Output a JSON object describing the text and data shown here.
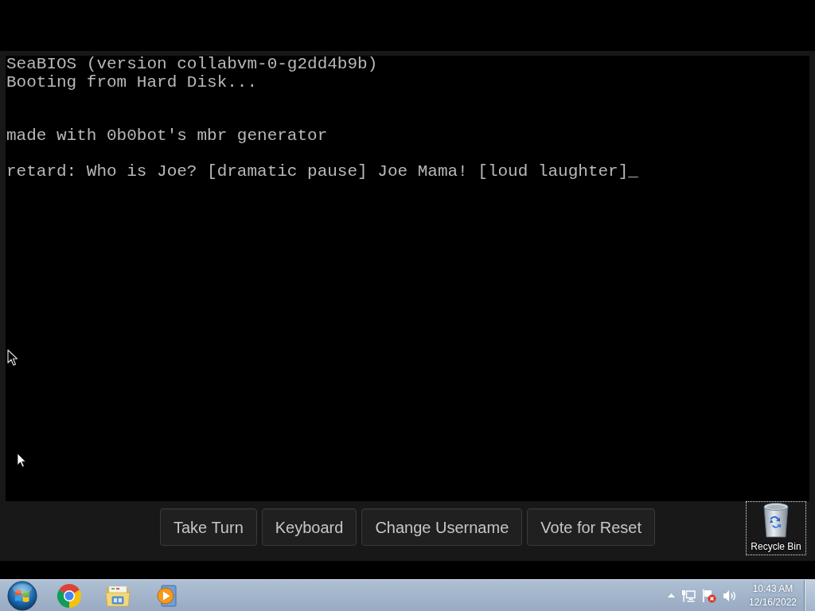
{
  "vm_console": {
    "lines": [
      "SeaBIOS (version collabvm-0-g2dd4b9b)",
      "Booting from Hard Disk...",
      "made with 0b0bot's mbr generator",
      "retard: Who is Joe? [dramatic pause] Joe Mama! [loud laughter]_"
    ]
  },
  "control_bar": {
    "buttons": [
      "Take Turn",
      "Keyboard",
      "Change Username",
      "Vote for Reset"
    ]
  },
  "desktop_icons": [
    {
      "label": "Recycle Bin",
      "selected": true
    }
  ],
  "taskbar": {
    "clock": {
      "time": "10:43 AM",
      "date": "12/16/2022"
    }
  }
}
